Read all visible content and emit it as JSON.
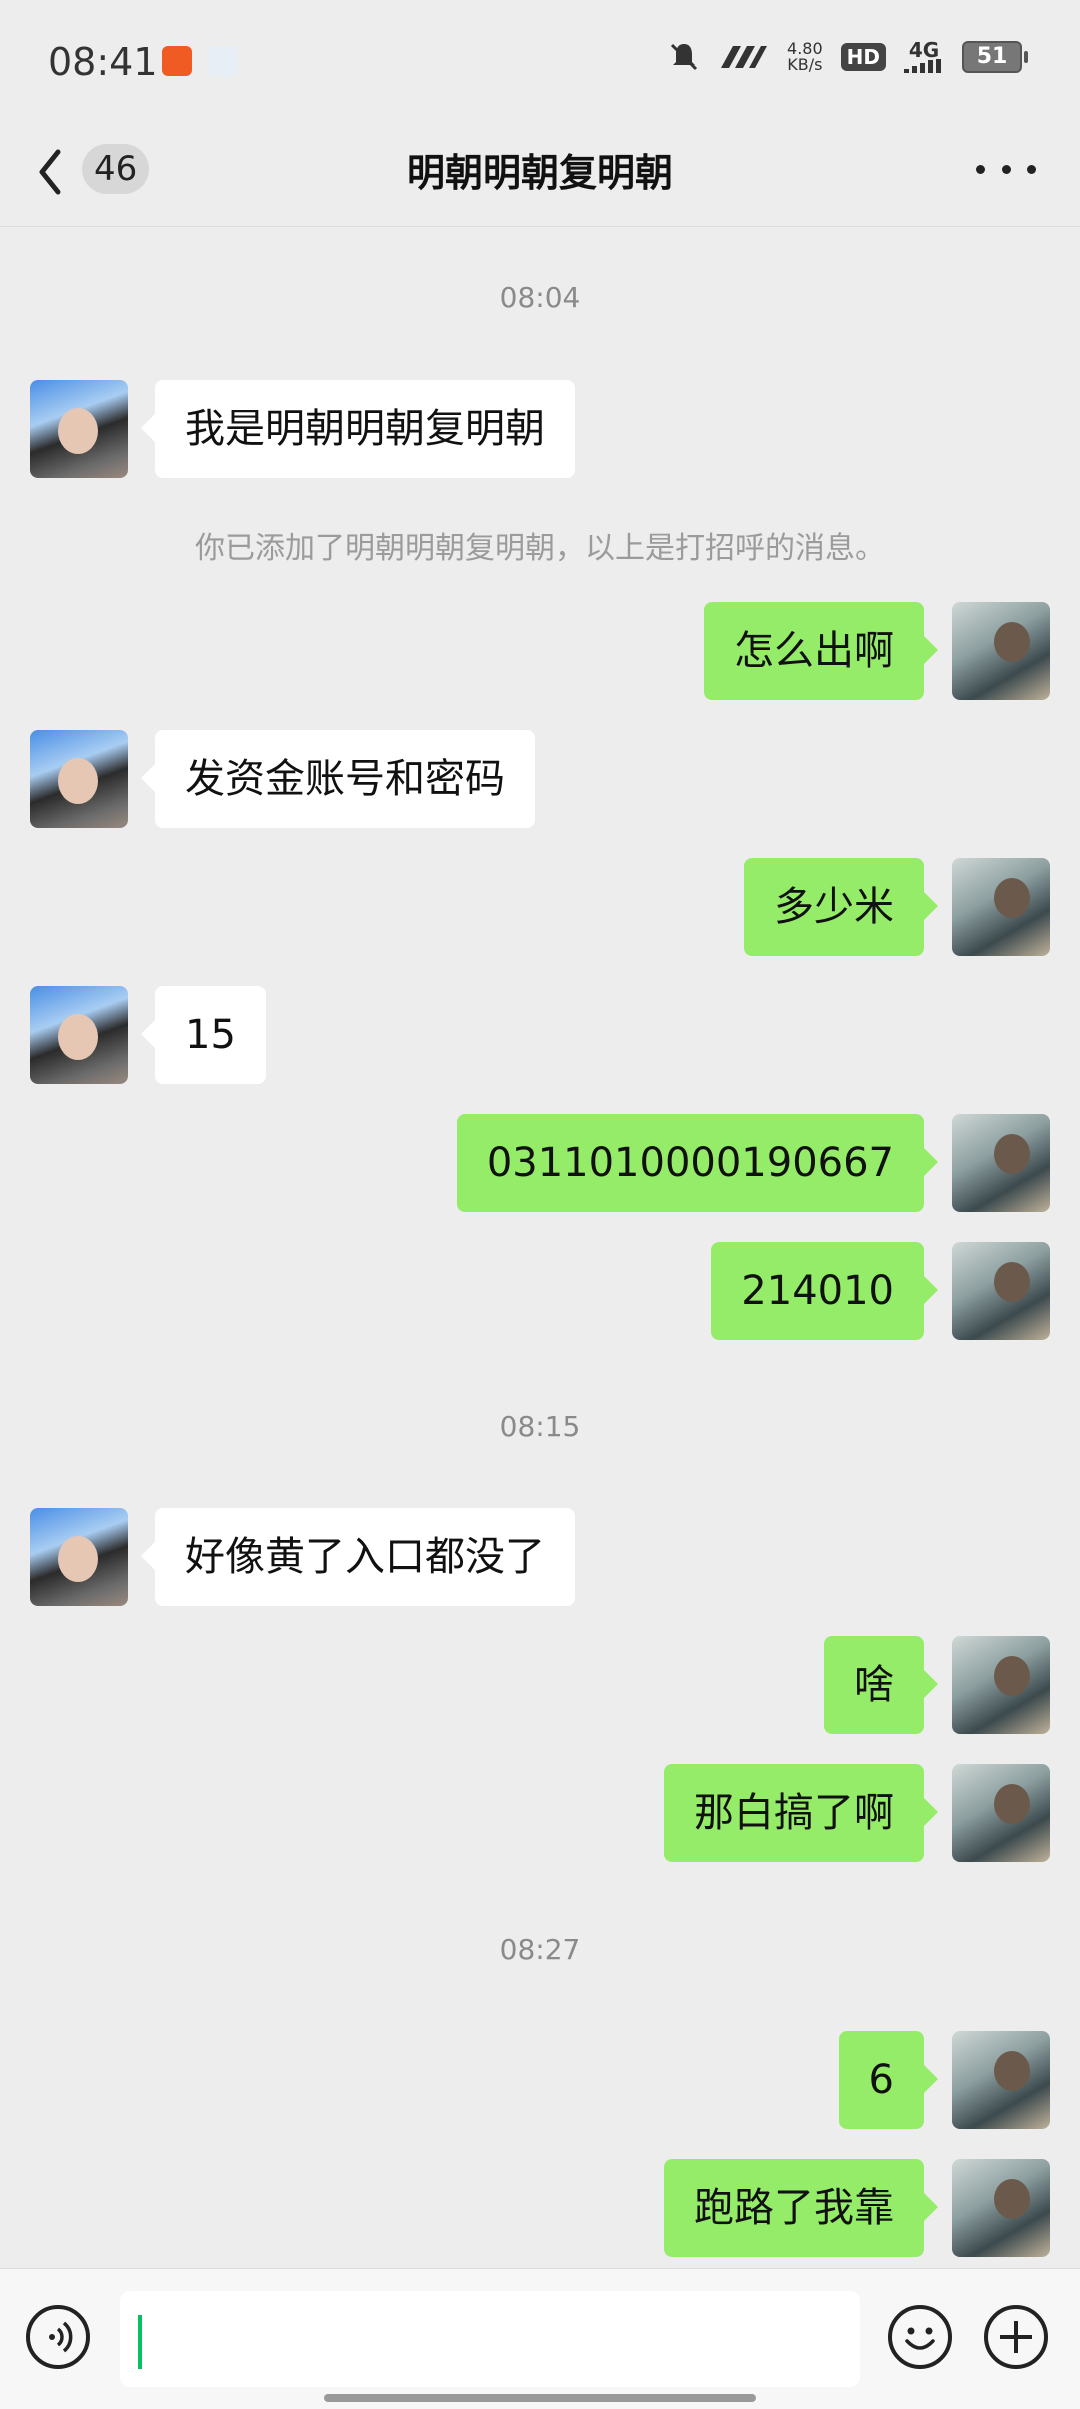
{
  "status_bar": {
    "time": "08:41",
    "speed_value": "4.80",
    "speed_unit": "KB/s",
    "hd": "HD",
    "network": "4G",
    "battery": "51"
  },
  "header": {
    "unread_count": "46",
    "title": "明朝明朝复明朝"
  },
  "chat": {
    "timestamps": [
      "08:04",
      "08:15",
      "08:27"
    ],
    "system_notice": "你已添加了明朝明朝复明朝，以上是打招呼的消息。",
    "messages": [
      {
        "side": "left",
        "text": "我是明朝明朝复明朝"
      },
      {
        "side": "right",
        "text": "怎么出啊"
      },
      {
        "side": "left",
        "text": "发资金账号和密码"
      },
      {
        "side": "right",
        "text": "多少米"
      },
      {
        "side": "left",
        "text": "15"
      },
      {
        "side": "right",
        "text": "0311010000190667"
      },
      {
        "side": "right",
        "text": "214010"
      },
      {
        "side": "left",
        "text": "好像黄了入口都没了"
      },
      {
        "side": "right",
        "text": "啥"
      },
      {
        "side": "right",
        "text": "那白搞了啊"
      },
      {
        "side": "right",
        "text": "6"
      },
      {
        "side": "right",
        "text": "跑路了我靠"
      }
    ]
  },
  "colors": {
    "sent_bubble": "#95ec69",
    "received_bubble": "#ffffff",
    "background": "#ededed",
    "caret": "#07c160"
  },
  "icons": {
    "back": "chevron-left-icon",
    "more": "more-dots-icon",
    "voice": "voice-icon",
    "emoji": "emoji-icon",
    "plus": "plus-icon"
  }
}
